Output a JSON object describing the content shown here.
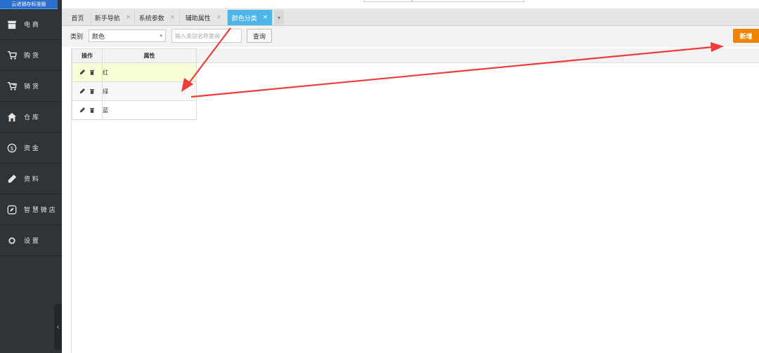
{
  "brand": "云进销存标准版",
  "sidebar": {
    "items": [
      {
        "label": "电 商",
        "icon": "store-icon"
      },
      {
        "label": "购 货",
        "icon": "cart-icon"
      },
      {
        "label": "销 货",
        "icon": "cart-out-icon"
      },
      {
        "label": "仓 库",
        "icon": "warehouse-icon"
      },
      {
        "label": "资 金",
        "icon": "dollar-icon"
      },
      {
        "label": "资 料",
        "icon": "pencil-icon"
      },
      {
        "label": "智 慧 微 店",
        "icon": "wechat-store-icon"
      },
      {
        "label": "设 置",
        "icon": "gear-icon"
      }
    ],
    "collapse_glyph": "‹"
  },
  "tabs": [
    {
      "label": "首页",
      "closable": false
    },
    {
      "label": "新手导航",
      "closable": true
    },
    {
      "label": "系统参数",
      "closable": true
    },
    {
      "label": "辅助属性",
      "closable": true
    },
    {
      "label": "颜色分类",
      "closable": true,
      "active": true
    }
  ],
  "tab_close_glyph": "×",
  "tab_more_glyph": "▾",
  "toolbar": {
    "category_label": "类别",
    "category_value": "颜色",
    "select_arrow": "▾",
    "search_placeholder": "输入类别名称查询",
    "query_label": "查询",
    "add_label": "新增"
  },
  "table": {
    "headers": {
      "operation": "操作",
      "attribute": "属性"
    },
    "rows": [
      {
        "attribute": "红"
      },
      {
        "attribute": "绿"
      },
      {
        "attribute": "蓝"
      }
    ]
  },
  "colors": {
    "sidebar_bg": "#2f3438",
    "active_tab": "#4fb5e8",
    "add_button": "#f08300",
    "arrow": "#ee3b3b",
    "highlight_row": "#f7ffd8"
  }
}
